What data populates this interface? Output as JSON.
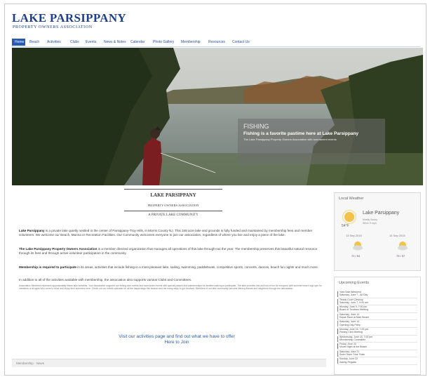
{
  "header": {
    "title": "LAKE PARSIPPANY",
    "subtitle": "PROPERTY OWNERS ASSOCIATION"
  },
  "nav": {
    "items": [
      "Home",
      "Beach",
      "Activities",
      "Clubs",
      "Events",
      "News & Notes",
      "Calendar",
      "Photo Gallery",
      "Membership",
      "Resources",
      "Contact Us"
    ]
  },
  "hero": {
    "caption_title": "FISHING",
    "caption_text": "Fishing is a favorite pastime here at Lake Parsippany",
    "caption_small": "The Lake Parsippany Property Owners Association with tournament events"
  },
  "intro": {
    "title": "LAKE PARSIPPANY",
    "subtitle": "PROPERTY OWNERS ASSOCIATION",
    "tagline": "A PRIVATE LAKE COMMUNITY",
    "p1_lead": "Lake Parsippany",
    "p1": " is a private lake quietly nestled in the center of Parsippany-Troy Hills, in Morris County NJ. This 348 acre lake and grounds is fully funded and maintained by membership fees and member volunteers. We welcome our Beach, Marina or Recreation Facilities. Our Community welcomes everyone to join our association, regardless of where you live and enjoy a piece of the lake.",
    "p2_lead": "The Lake Parsippany Property Owners Association",
    "p2": " is a member directed organization that manages all operations of this lake through-out the year. The membership preserves this beautiful natural resource through its fees and through active volunteer participation in the community.",
    "p3_lead": "Membership is required to participate",
    "p3": " in its areas, activities that include fishing in a most pleasant lake, sailing, swimming, paddleboats, competitive sports, concerts, dances, beach fun nights and much more.",
    "p4": "In addition to all of the activities available with membership, the association also supports various Clubs and Committees.",
    "p4_link": "Clubs and Committees.",
    "fine": "Association Members represent approximately these lake activities. Your Association supports our fishing club events and swim team events with special passes and memberships for families wishing to participate. The lake provides lots and lots of fun for everyone with summer beach sign-ups for members of all ages who come to relax and enjoy their summers here. Check out our events calendar for all the happenings this season and the many ways to get involved. Members of our lake community become lifelong friends and neighbors through the association."
  },
  "cta": {
    "line1": "Visit our activities page and find out what we have to offer",
    "line2": "Here to Join"
  },
  "bottom": {
    "label": "Membership · News"
  },
  "weather": {
    "title": "Local Weather",
    "location": "Lake Parsippany",
    "details": [
      "Mostly Sunny",
      "Wind: 5 mph"
    ],
    "temp": "54°F",
    "forecast": [
      {
        "date": "13 Sep 2015",
        "temp": "72 / 54"
      },
      {
        "date": "14 Sep 2015",
        "temp": "75 / 57"
      }
    ]
  },
  "events": {
    "title": "Upcoming Events",
    "items": [
      {
        "text": "Yard Sale Weekend",
        "sub": "Saturday, June 7 - All Day",
        "color": "#d23cc6"
      },
      {
        "text": "Tennis Court Cleanup",
        "sub": "Saturday, June 7, 9:00 am",
        "color": "#3c8fd2"
      },
      {
        "text": "Monday, June 9, 7:00 pm",
        "sub": "Board of Trustees Meeting",
        "color": "#3c8fd2"
      },
      {
        "text": "Saturday, June 14",
        "sub": "Kayak Race at Main Beach",
        "color": "#d2a03c"
      },
      {
        "text": "Saturday, June 14",
        "sub": "Opening Day Party",
        "color": "#3cd28c"
      },
      {
        "text": "Monday, June 16, 7:00 pm",
        "sub": "Fishing Club Meeting",
        "color": "#d23c3c"
      },
      {
        "text": "Wednesday, June 18, 7:00 pm",
        "sub": "Membership Committee",
        "color": "#3c8fd2"
      },
      {
        "text": "Friday, June 20",
        "sub": "Movie Night at the Beach",
        "color": "#8c3cd2"
      },
      {
        "text": "Saturday, June 21",
        "sub": "Swim Team Time Trials",
        "color": "#3c8fd2"
      },
      {
        "text": "Sunday, June 22",
        "sub": "Sailing Regatta",
        "color": "#d23cc6"
      }
    ]
  }
}
